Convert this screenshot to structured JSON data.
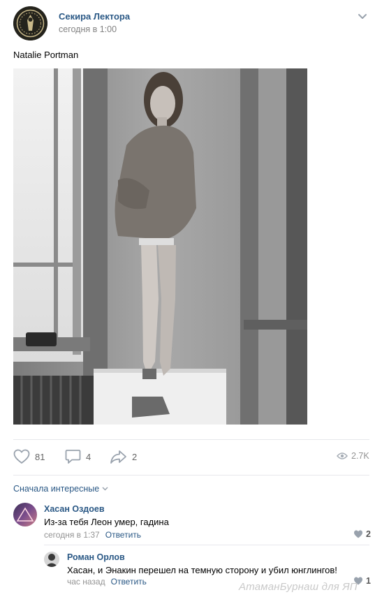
{
  "post": {
    "author": "Секира Лектора",
    "time": "сегодня в 1:00",
    "text": "Natalie Portman"
  },
  "actions": {
    "likes": "81",
    "comments": "4",
    "shares": "2",
    "views": "2.7K"
  },
  "comments": {
    "sort_label": "Сначала интересные",
    "items": [
      {
        "name": "Хасан Оздоев",
        "text": "Из-за тебя Леон умер, гадина",
        "time": "сегодня в 1:37",
        "reply": "Ответить",
        "likes": "2"
      },
      {
        "name": "Роман Орлов",
        "text": "Хасан, и Энакин перешел на темную сторону и убил юнглингов!",
        "time": "час назад",
        "reply": "Ответить",
        "likes": "1"
      }
    ]
  },
  "watermark": "АтаманБурнаш для ЯП",
  "colors": {
    "link": "#2a5885",
    "muted": "#939393",
    "divider": "#e7e8ec"
  }
}
